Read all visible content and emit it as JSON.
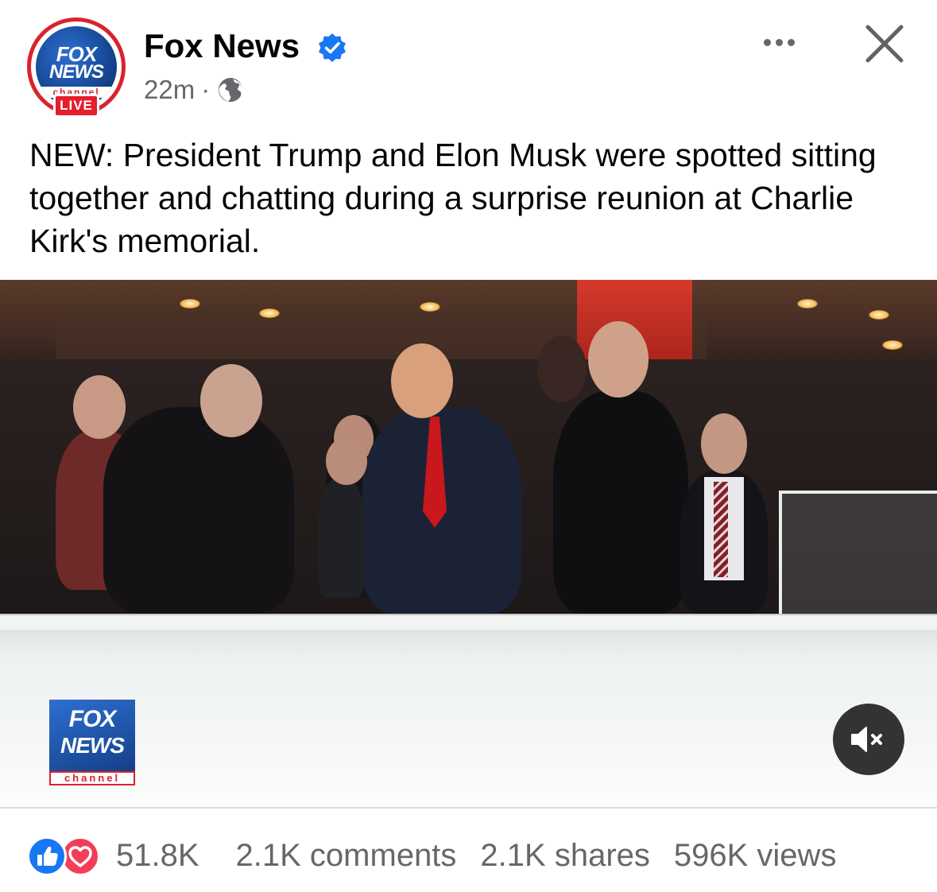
{
  "post": {
    "page_name": "Fox News",
    "time_ago": "22m",
    "separator": "·",
    "live_badge": "LIVE",
    "avatar_logo": {
      "line1": "FOX",
      "line2": "NEWS",
      "line3": "channel"
    },
    "text": "NEW: President Trump and Elon Musk were spotted sitting together and chatting during a surprise reunion at Charlie Kirk's memorial."
  },
  "video": {
    "watermark": {
      "line1": "FOX",
      "line2": "NEWS",
      "line3": "channel"
    },
    "muted": true
  },
  "stats": {
    "reactions": "51.8K",
    "comments": "2.1K comments",
    "shares": "2.1K shares",
    "views": "596K views"
  },
  "icons": {
    "verified": "verified-badge-icon",
    "audience": "globe-icon",
    "more": "more-horizontal-icon",
    "close": "close-icon",
    "mute": "speaker-muted-icon",
    "like": "like-reaction-icon",
    "love": "love-reaction-icon"
  },
  "colors": {
    "brand_blue": "#1877f2",
    "live_red": "#e41e2b",
    "fox_blue": "#143f89",
    "love_red": "#f33e58",
    "muted_text": "#65676b"
  }
}
